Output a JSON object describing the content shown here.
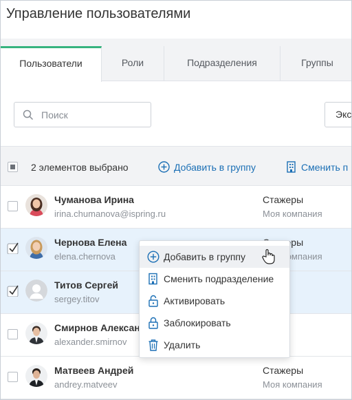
{
  "page": {
    "title": "Управление пользователями"
  },
  "tabs": [
    {
      "label": "Пользователи",
      "active": true
    },
    {
      "label": "Роли",
      "active": false
    },
    {
      "label": "Подразделения",
      "active": false
    },
    {
      "label": "Группы",
      "active": false
    }
  ],
  "search": {
    "placeholder": "Поиск"
  },
  "export_button": {
    "label": "Экс"
  },
  "toolbar": {
    "selected_text": "2 элементов выбрано",
    "add_to_group": "Добавить в группу",
    "change_dept": "Сменить п"
  },
  "users": [
    {
      "name": "Чуманова Ирина",
      "login": "irina.chumanova@ispring.ru",
      "group": "Стажеры",
      "org": "Моя компания",
      "selected": false,
      "avatar": "woman-dark-hair"
    },
    {
      "name": "Чернова Елена",
      "login": "elena.chernova",
      "group": "Стажеры",
      "org": "Моя компания",
      "selected": true,
      "avatar": "woman-blonde"
    },
    {
      "name": "Титов Сергей",
      "login": "sergey.titov",
      "group": "",
      "org": "",
      "selected": true,
      "avatar": "default-user"
    },
    {
      "name": "Смирнов Алексан",
      "login": "alexander.smirnov",
      "group": "",
      "org": "",
      "selected": false,
      "avatar": "man-suit"
    },
    {
      "name": "Матвеев Андрей",
      "login": "andrey.matveev",
      "group": "Стажеры",
      "org": "Моя компания",
      "selected": false,
      "avatar": "man-suit-dark"
    }
  ],
  "context_menu": {
    "items": [
      {
        "label": "Добавить в группу",
        "icon": "plus-circle-icon"
      },
      {
        "label": "Сменить подразделение",
        "icon": "building-icon"
      },
      {
        "label": "Активировать",
        "icon": "unlock-icon"
      },
      {
        "label": "Заблокировать",
        "icon": "lock-icon"
      },
      {
        "label": "Удалить",
        "icon": "trash-icon"
      }
    ]
  },
  "colors": {
    "accent": "#1b6fb5",
    "tab_active": "#36b37e",
    "selected_row": "#e7f2fc"
  }
}
